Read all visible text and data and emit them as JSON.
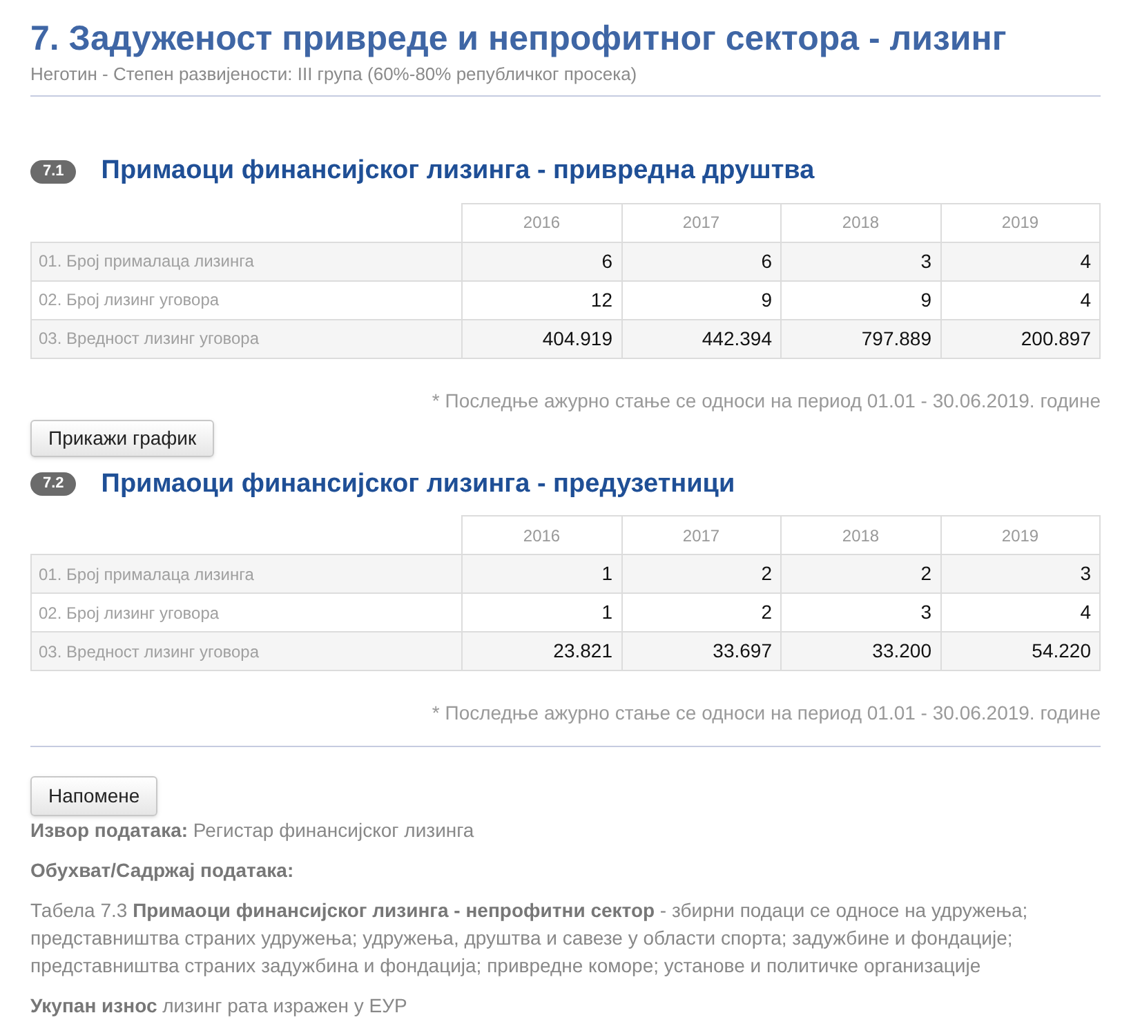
{
  "title": "7. Задуженост привреде и непрофитног сектора - лизинг",
  "subtitle": "Неготин - Степен развијености: III група (60%-80% републичког просека)",
  "sections": [
    {
      "number": "7.1",
      "heading": "Примаоци финансијског лизинга - привредна друштва",
      "columns": [
        "2016",
        "2017",
        "2018",
        "2019"
      ],
      "rows": [
        {
          "label": "01. Број прималаца лизинга",
          "values": [
            "6",
            "6",
            "3",
            "4"
          ]
        },
        {
          "label": "02. Број лизинг уговора",
          "values": [
            "12",
            "9",
            "9",
            "4"
          ]
        },
        {
          "label": "03. Вредност лизинг уговора",
          "values": [
            "404.919",
            "442.394",
            "797.889",
            "200.897"
          ]
        }
      ],
      "footnote": "* Последње ажурно стање се односи на период 01.01 - 30.06.2019. године",
      "button": "Прикажи график"
    },
    {
      "number": "7.2",
      "heading": "Примаоци финансијског лизинга - предузетници",
      "columns": [
        "2016",
        "2017",
        "2018",
        "2019"
      ],
      "rows": [
        {
          "label": "01. Број прималаца лизинга",
          "values": [
            "1",
            "2",
            "2",
            "3"
          ]
        },
        {
          "label": "02. Број лизинг уговора",
          "values": [
            "1",
            "2",
            "3",
            "4"
          ]
        },
        {
          "label": "03. Вредност лизинг уговора",
          "values": [
            "23.821",
            "33.697",
            "33.200",
            "54.220"
          ]
        }
      ],
      "footnote": "* Последње ажурно стање се односи на период 01.01 - 30.06.2019. године"
    }
  ],
  "notes_button": "Напомене",
  "notes": [
    "**Извор података:** Регистар финансијског лизинга",
    "**Обухват/Садржај података:**",
    "Табела 7.3 **Примаоци финансијског лизинга - непрофитни сектор** - збирни подаци се односе на удружења; представништва страних удружења; удружења, друштва и савезе у области спорта; задужбине и фондације; представништва страних задужбина и фондација; привредне коморе; установе и политичке организације",
    "**Укупан износ** лизинг рата изражен у ЕУР"
  ]
}
